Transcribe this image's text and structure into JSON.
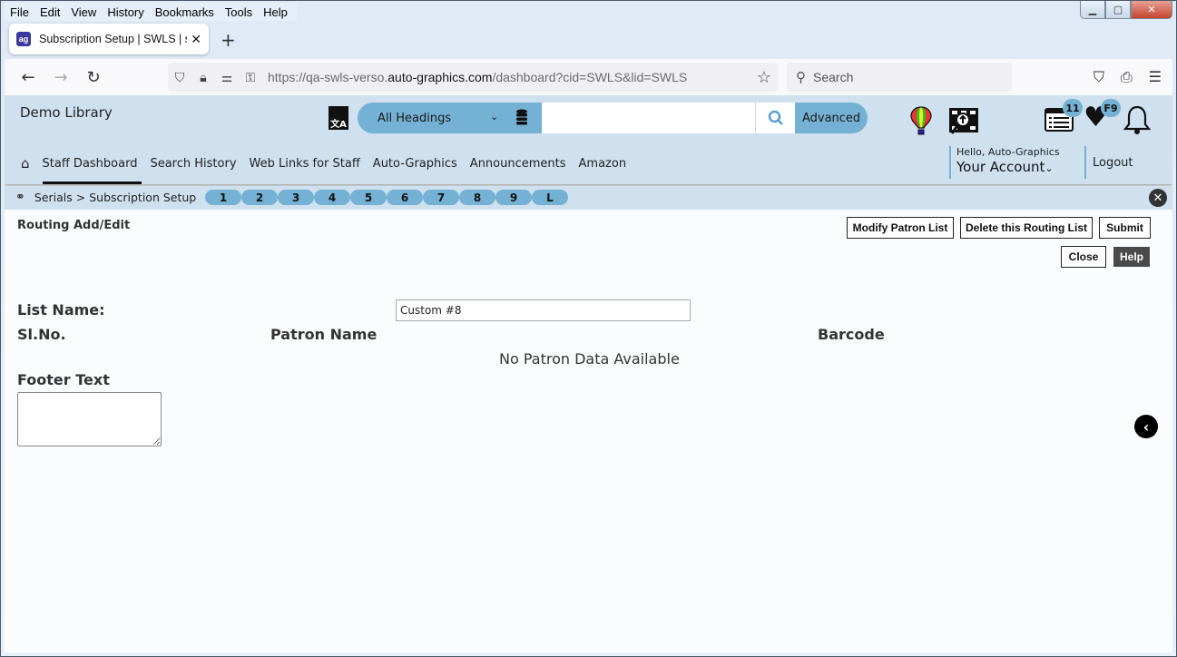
{
  "browser": {
    "menu": [
      "File",
      "Edit",
      "View",
      "History",
      "Bookmarks",
      "Tools",
      "Help"
    ],
    "tab": {
      "title": "Subscription Setup | SWLS | swls",
      "favicon": "ag"
    },
    "url": {
      "prefix": "https://qa-swls-verso.",
      "domain": "auto-graphics.com",
      "path": "/dashboard?cid=SWLS&lid=SWLS"
    },
    "search_placeholder": "Search"
  },
  "header": {
    "library_name": "Demo Library",
    "search_scope": "All Headings",
    "search_value": "",
    "advanced_label": "Advanced",
    "list_badge": "11",
    "heart_badge": "F9",
    "nav": [
      "Staff Dashboard",
      "Search History",
      "Web Links for Staff",
      "Auto-Graphics",
      "Announcements",
      "Amazon"
    ],
    "account": {
      "hello": "Hello, Auto-Graphics",
      "label": "Your Account"
    },
    "logout": "Logout"
  },
  "breadcrumb": {
    "path": "Serials > Subscription Setup",
    "pills": [
      "1",
      "2",
      "3",
      "4",
      "5",
      "6",
      "7",
      "8",
      "9",
      "L"
    ]
  },
  "form": {
    "title": "Routing Add/Edit",
    "buttons": {
      "modify": "Modify Patron List",
      "delete": "Delete this Routing List",
      "submit": "Submit",
      "close": "Close",
      "help": "Help"
    },
    "list_name_label": "List Name:",
    "list_name_value": "Custom #8",
    "columns": [
      "Sl.No.",
      "Patron Name",
      "Barcode"
    ],
    "empty_message": "No Patron Data Available",
    "footer_label": "Footer Text",
    "footer_value": ""
  },
  "colors": {
    "accent": "#74b1d4",
    "header_bg": "#cfe1ee"
  }
}
